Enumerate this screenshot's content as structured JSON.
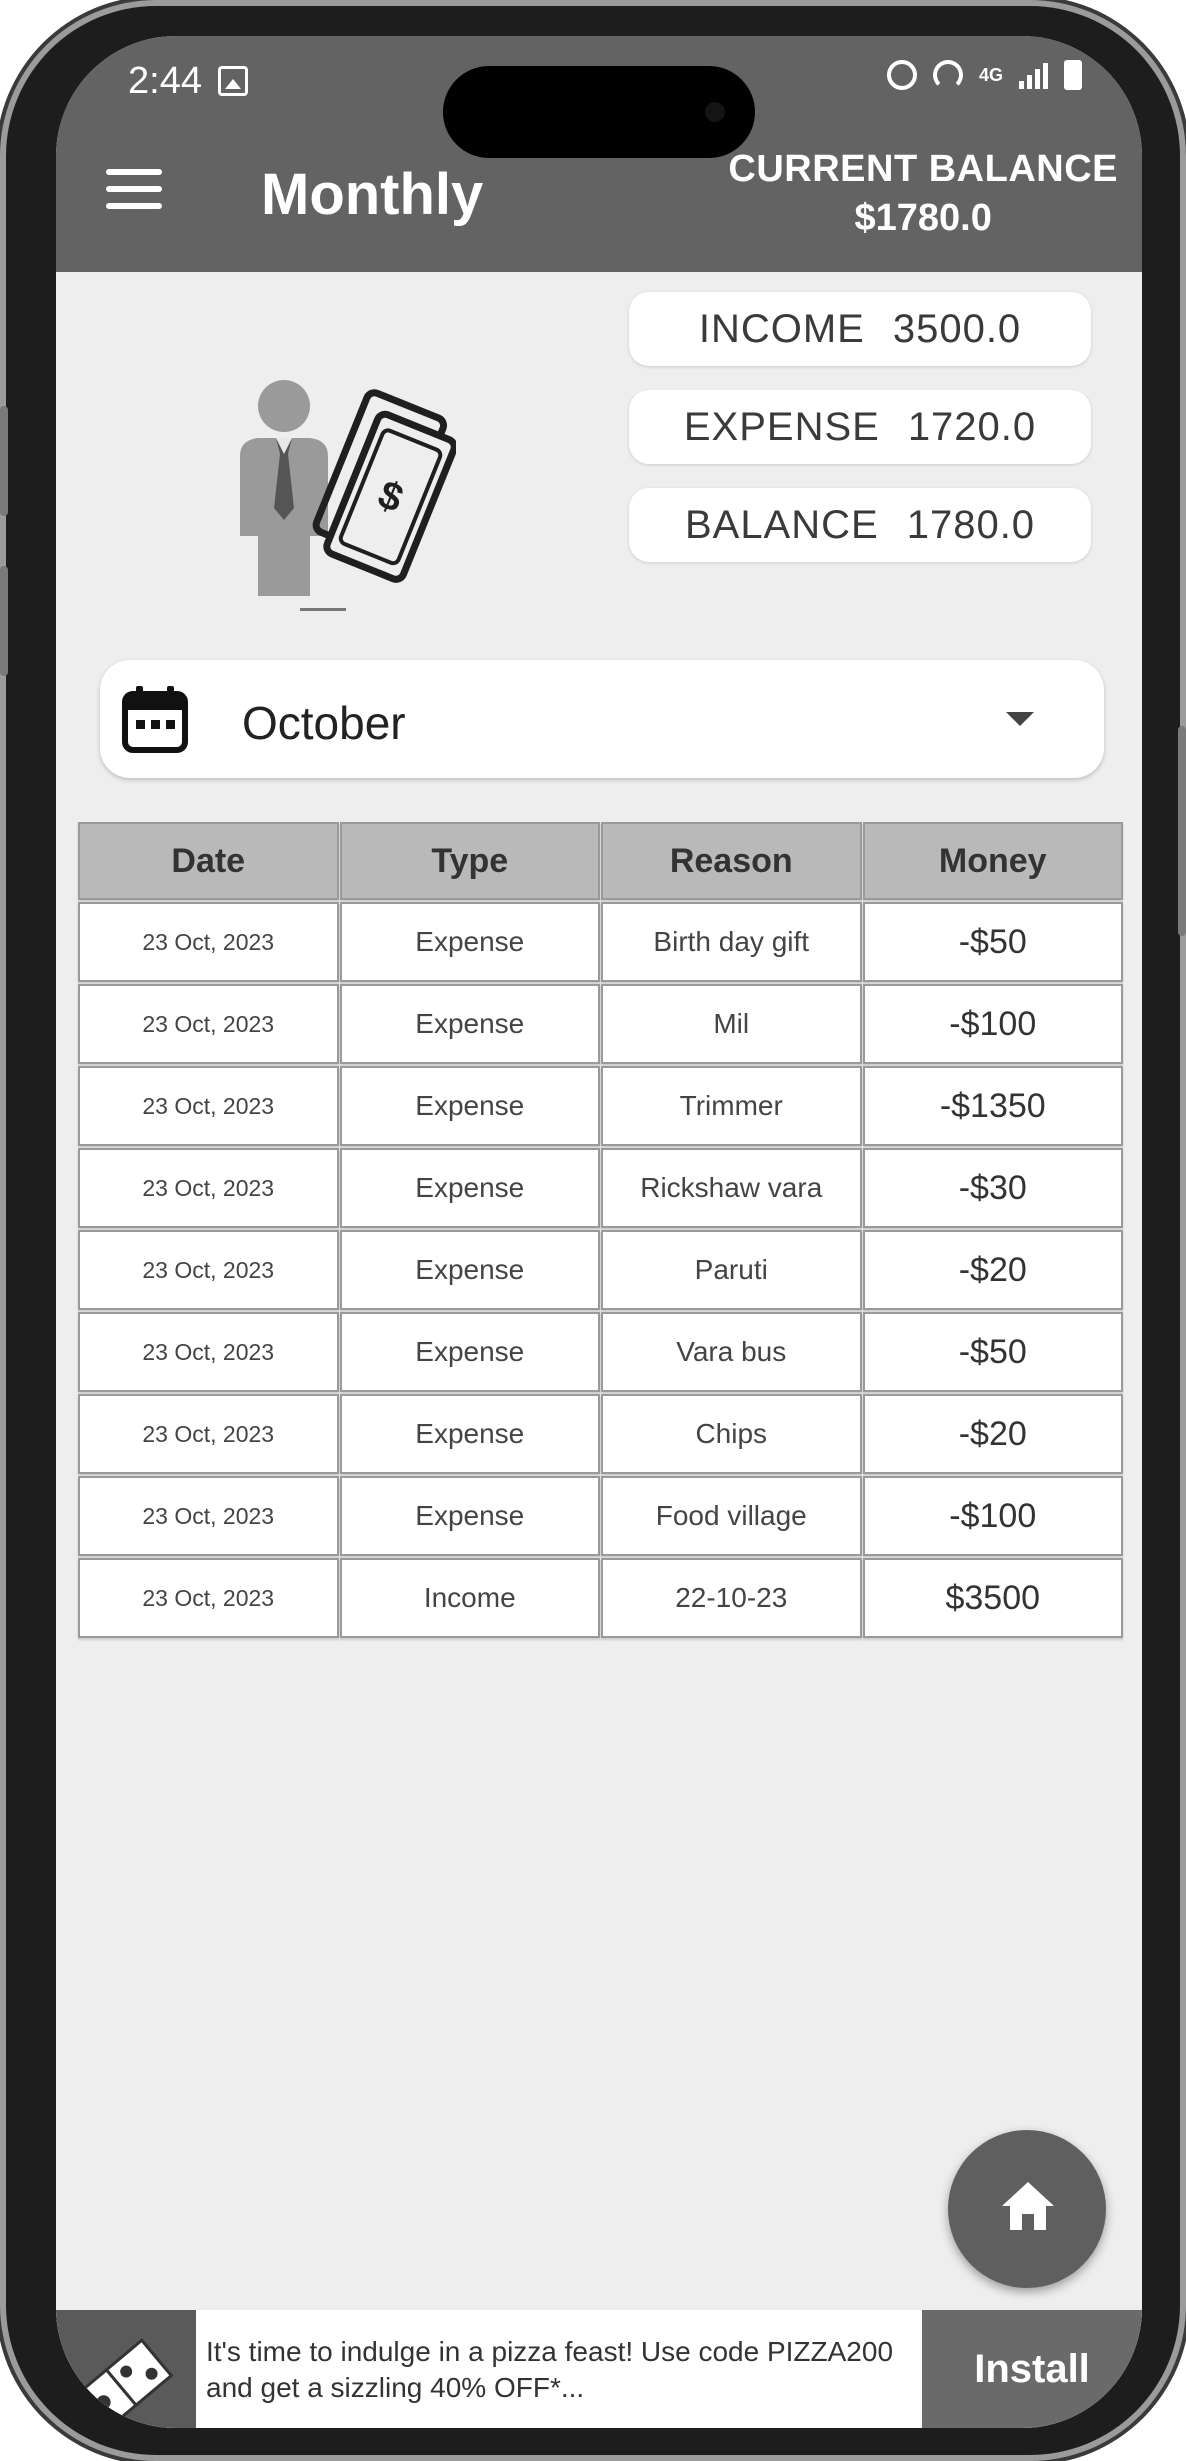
{
  "status_bar": {
    "time": "2:44",
    "network": "4G"
  },
  "app_bar": {
    "title": "Monthly",
    "balance_label": "CURRENT BALANCE",
    "balance_value": "$1780.0"
  },
  "summary": {
    "income_label": "INCOME",
    "income_value": "3500.0",
    "expense_label": "EXPENSE",
    "expense_value": "1720.0",
    "balance_label": "BALANCE",
    "balance_value": "1780.0"
  },
  "month_select": {
    "value": "October"
  },
  "table": {
    "headers": [
      "Date",
      "Type",
      "Reason",
      "Money"
    ],
    "rows": [
      {
        "date": "23 Oct, 2023",
        "type": "Expense",
        "reason": "Birth day gift",
        "money": "-$50"
      },
      {
        "date": "23 Oct, 2023",
        "type": "Expense",
        "reason": "Mil",
        "money": "-$100"
      },
      {
        "date": "23 Oct, 2023",
        "type": "Expense",
        "reason": "Trimmer",
        "money": "-$1350"
      },
      {
        "date": "23 Oct, 2023",
        "type": "Expense",
        "reason": "Rickshaw vara",
        "money": "-$30"
      },
      {
        "date": "23 Oct, 2023",
        "type": "Expense",
        "reason": "Paruti",
        "money": "-$20"
      },
      {
        "date": "23 Oct, 2023",
        "type": "Expense",
        "reason": "Vara bus",
        "money": "-$50"
      },
      {
        "date": "23 Oct, 2023",
        "type": "Expense",
        "reason": "Chips",
        "money": "-$20"
      },
      {
        "date": "23 Oct, 2023",
        "type": "Expense",
        "reason": "Food village",
        "money": "-$100"
      },
      {
        "date": "23 Oct, 2023",
        "type": "Income",
        "reason": "22-10-23",
        "money": "$3500"
      }
    ]
  },
  "ad": {
    "text": "It's time to indulge in a pizza feast! Use code PIZZA200 and get a sizzling 40% OFF*...",
    "install_label": "Install"
  },
  "icons": {
    "menu": "menu-icon",
    "calendar": "calendar-icon",
    "dropdown": "chevron-down-icon",
    "home": "home-icon",
    "illustration": "businessman-money-icon"
  },
  "colors": {
    "app_bar": "#636363",
    "background": "#eeeeee",
    "table_header": "#b9b9b9",
    "fab": "#5f5f5f"
  }
}
